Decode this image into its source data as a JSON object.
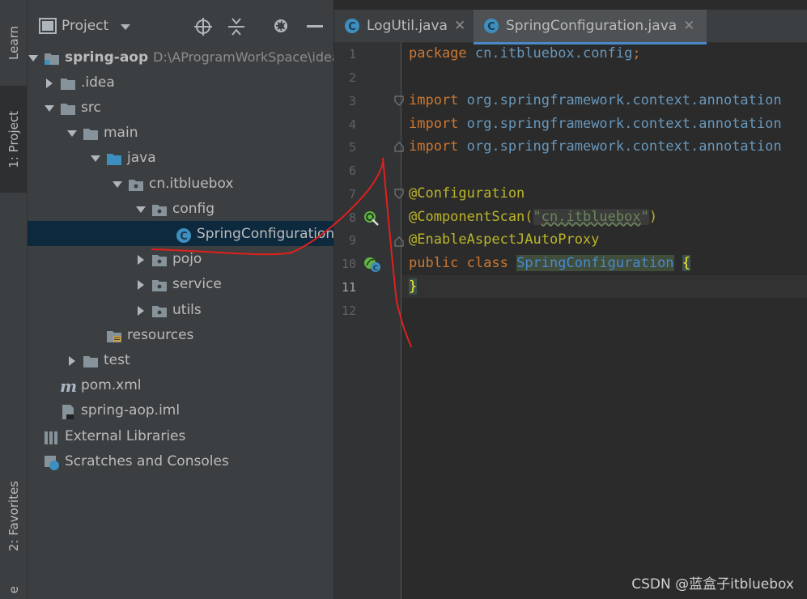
{
  "sidebar_tabs": {
    "learn": "Learn",
    "project": "1: Project",
    "favorites": "2: Favorites",
    "structure": "e"
  },
  "project_panel": {
    "title": "Project",
    "tree": [
      {
        "label": "spring-aop",
        "path": "D:\\AProgramWorkSpace\\idea\\sp",
        "icon": "module-folder-icon",
        "arrow": "down",
        "depth": 0
      },
      {
        "label": ".idea",
        "icon": "folder-icon",
        "arrow": "right",
        "depth": 1
      },
      {
        "label": "src",
        "icon": "folder-icon",
        "arrow": "down",
        "depth": 1
      },
      {
        "label": "main",
        "icon": "folder-icon",
        "arrow": "down",
        "depth": 2
      },
      {
        "label": "java",
        "icon": "source-folder-icon",
        "arrow": "down",
        "depth": 3
      },
      {
        "label": "cn.itbluebox",
        "icon": "package-icon",
        "arrow": "down",
        "depth": 4
      },
      {
        "label": "config",
        "icon": "package-icon",
        "arrow": "down",
        "depth": 5
      },
      {
        "label": "SpringConfiguration",
        "icon": "java-class-icon",
        "arrow": "none",
        "depth": 6,
        "selected": true
      },
      {
        "label": "pojo",
        "icon": "package-icon",
        "arrow": "right",
        "depth": 5
      },
      {
        "label": "service",
        "icon": "package-icon",
        "arrow": "right",
        "depth": 5
      },
      {
        "label": "utils",
        "icon": "package-icon",
        "arrow": "right",
        "depth": 5
      },
      {
        "label": "resources",
        "icon": "resources-folder-icon",
        "arrow": "none",
        "depth": 3
      },
      {
        "label": "test",
        "icon": "folder-icon",
        "arrow": "right",
        "depth": 2
      },
      {
        "label": "pom.xml",
        "icon": "maven-icon",
        "arrow": "none",
        "depth": 1
      },
      {
        "label": "spring-aop.iml",
        "icon": "iml-file-icon",
        "arrow": "none",
        "depth": 1
      },
      {
        "label": "External Libraries",
        "icon": "libraries-icon",
        "arrow": "none",
        "depth": 0
      },
      {
        "label": "Scratches and Consoles",
        "icon": "scratches-icon",
        "arrow": "none",
        "depth": 0
      }
    ]
  },
  "editor": {
    "tabs": [
      {
        "label": "LogUtil.java",
        "active": false
      },
      {
        "label": "SpringConfiguration.java",
        "active": true
      }
    ],
    "line_numbers": [
      "1",
      "2",
      "3",
      "4",
      "5",
      "6",
      "7",
      "8",
      "9",
      "10",
      "11",
      "12"
    ],
    "code": {
      "l1_kw": "package",
      "l1_pkg": "cn.itbluebox.config",
      "l1_semi": ";",
      "l3_kw": "import",
      "l3_pkg": "org.springframework.context.annotation",
      "l4_kw": "import",
      "l4_pkg": "org.springframework.context.annotation",
      "l5_kw": "import",
      "l5_pkg": "org.springframework.context.annotation",
      "l7_ann": "@Configuration",
      "l8_ann": "@ComponentScan(",
      "l8_str_q1": "\"",
      "l8_str": "cn.itbluebox",
      "l8_str_q2": "\"",
      "l8_close": ")",
      "l9_ann": "@EnableAspectJAutoProxy",
      "l10_kw": "public class",
      "l10_cls": "SpringConfiguration",
      "l10_brace": "{",
      "l11_brace": "}"
    }
  },
  "watermark": "CSDN @蓝盒子itbluebox"
}
